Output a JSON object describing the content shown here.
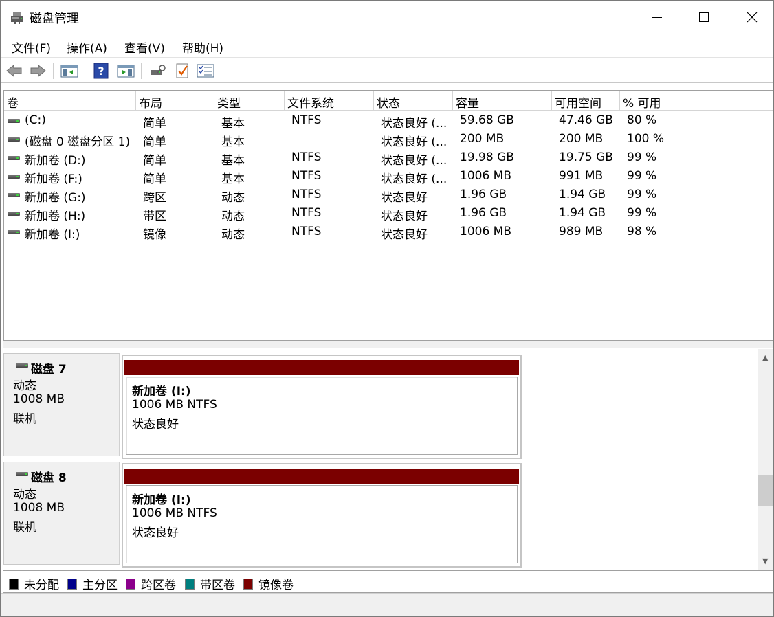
{
  "window": {
    "title": "磁盘管理"
  },
  "menu": [
    "文件(F)",
    "操作(A)",
    "查看(V)",
    "帮助(H)"
  ],
  "toolbar": {
    "icons": [
      "back-icon",
      "forward-icon",
      "console-tree-icon",
      "help-icon",
      "properties-pane-icon",
      "connect-drive-icon",
      "checkmark-doc-icon",
      "list-view-icon"
    ]
  },
  "volumes": {
    "columns": [
      "卷",
      "布局",
      "类型",
      "文件系统",
      "状态",
      "容量",
      "可用空间",
      "% 可用"
    ],
    "rows": [
      {
        "volume": "(C:)",
        "layout": "简单",
        "type": "基本",
        "fs": "NTFS",
        "status": "状态良好 (...",
        "capacity": "59.68 GB",
        "free": "47.46 GB",
        "pct": "80 %"
      },
      {
        "volume": "(磁盘 0 磁盘分区 1)",
        "layout": "简单",
        "type": "基本",
        "fs": "",
        "status": "状态良好 (...",
        "capacity": "200 MB",
        "free": "200 MB",
        "pct": "100 %"
      },
      {
        "volume": "新加卷 (D:)",
        "layout": "简单",
        "type": "基本",
        "fs": "NTFS",
        "status": "状态良好 (...",
        "capacity": "19.98 GB",
        "free": "19.75 GB",
        "pct": "99 %"
      },
      {
        "volume": "新加卷 (F:)",
        "layout": "简单",
        "type": "基本",
        "fs": "NTFS",
        "status": "状态良好 (...",
        "capacity": "1006 MB",
        "free": "991 MB",
        "pct": "99 %"
      },
      {
        "volume": "新加卷 (G:)",
        "layout": "跨区",
        "type": "动态",
        "fs": "NTFS",
        "status": "状态良好",
        "capacity": "1.96 GB",
        "free": "1.94 GB",
        "pct": "99 %"
      },
      {
        "volume": "新加卷 (H:)",
        "layout": "带区",
        "type": "动态",
        "fs": "NTFS",
        "status": "状态良好",
        "capacity": "1.96 GB",
        "free": "1.94 GB",
        "pct": "99 %"
      },
      {
        "volume": "新加卷 (I:)",
        "layout": "镜像",
        "type": "动态",
        "fs": "NTFS",
        "status": "状态良好",
        "capacity": "1006 MB",
        "free": "989 MB",
        "pct": "98 %"
      }
    ]
  },
  "disks": [
    {
      "name": "磁盘 7",
      "kind": "动态",
      "size": "1008 MB",
      "state": "联机",
      "partition": {
        "name": "新加卷  (I:)",
        "info": "1006 MB NTFS",
        "status": "状态良好",
        "color": "#7b0000"
      }
    },
    {
      "name": "磁盘 8",
      "kind": "动态",
      "size": "1008 MB",
      "state": "联机",
      "partition": {
        "name": "新加卷  (I:)",
        "info": "1006 MB NTFS",
        "status": "状态良好",
        "color": "#7b0000"
      }
    }
  ],
  "legend": [
    {
      "label": "未分配",
      "color": "#000000"
    },
    {
      "label": "主分区",
      "color": "#00008b"
    },
    {
      "label": "跨区卷",
      "color": "#8b008b"
    },
    {
      "label": "带区卷",
      "color": "#008080"
    },
    {
      "label": "镜像卷",
      "color": "#7b0000"
    }
  ]
}
